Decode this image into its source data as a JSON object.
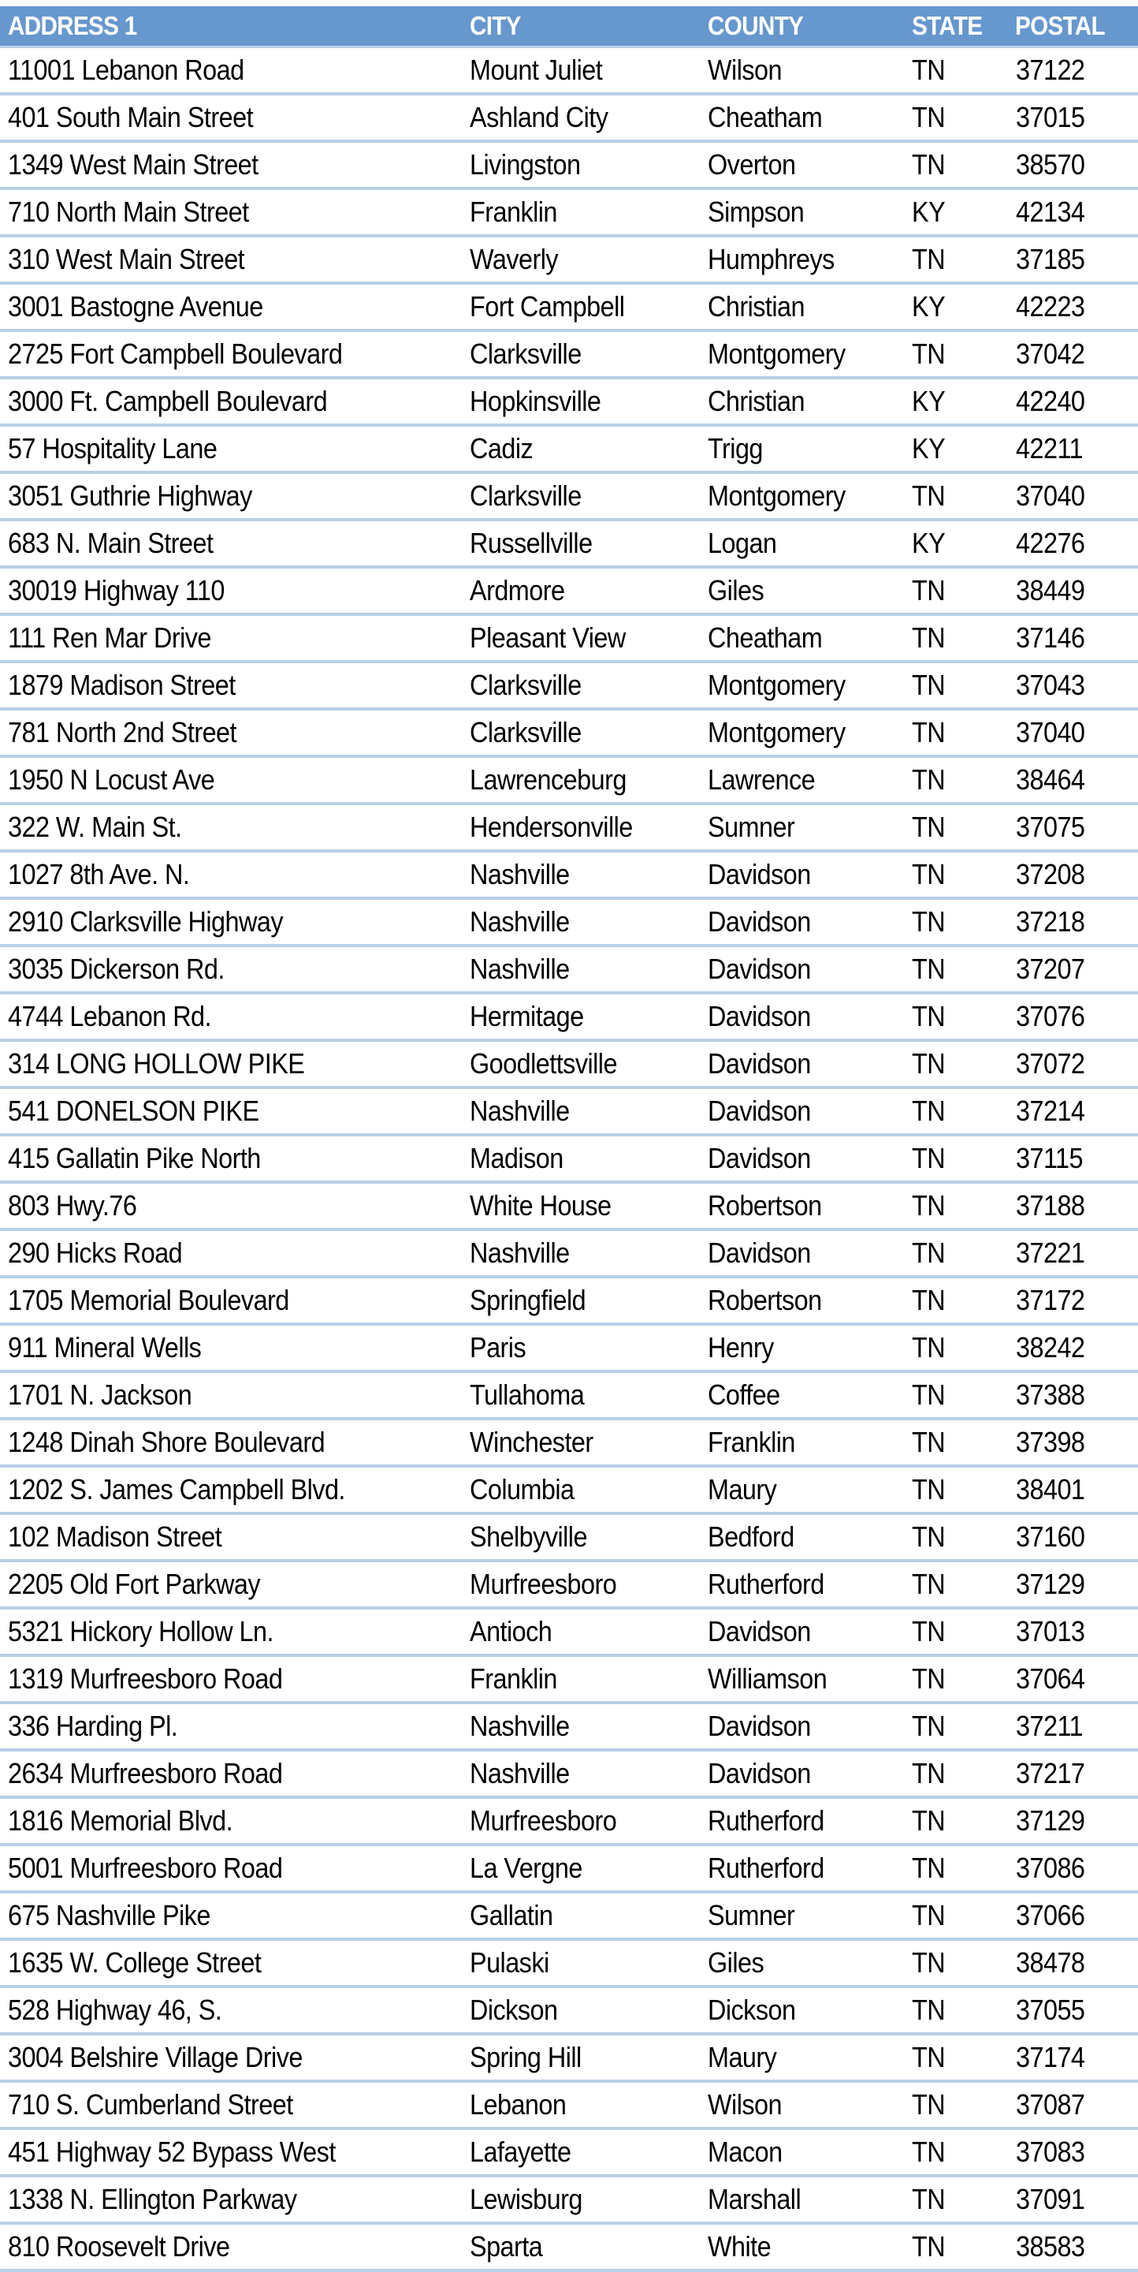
{
  "table": {
    "headers": [
      "ADDRESS 1",
      "CITY",
      "COUNTY",
      "STATE",
      "POSTAL"
    ],
    "accent_color": "#6697CD",
    "rows": [
      [
        "11001 Lebanon Road",
        "Mount Juliet",
        "Wilson",
        "TN",
        "37122"
      ],
      [
        "401 South Main Street",
        "Ashland City",
        "Cheatham",
        "TN",
        "37015"
      ],
      [
        "1349 West Main Street",
        "Livingston",
        "Overton",
        "TN",
        "38570"
      ],
      [
        "710 North Main Street",
        "Franklin",
        "Simpson",
        "KY",
        "42134"
      ],
      [
        "310 West Main Street",
        "Waverly",
        "Humphreys",
        "TN",
        "37185"
      ],
      [
        "3001 Bastogne Avenue",
        "Fort Campbell",
        "Christian",
        "KY",
        "42223"
      ],
      [
        "2725 Fort Campbell Boulevard",
        "Clarksville",
        "Montgomery",
        "TN",
        "37042"
      ],
      [
        "3000 Ft. Campbell Boulevard",
        "Hopkinsville",
        "Christian",
        "KY",
        "42240"
      ],
      [
        "57 Hospitality Lane",
        "Cadiz",
        "Trigg",
        "KY",
        "42211"
      ],
      [
        "3051 Guthrie Highway",
        "Clarksville",
        "Montgomery",
        "TN",
        "37040"
      ],
      [
        "683 N. Main Street",
        "Russellville",
        "Logan",
        "KY",
        "42276"
      ],
      [
        "30019 Highway 110",
        "Ardmore",
        "Giles",
        "TN",
        "38449"
      ],
      [
        "111 Ren Mar Drive",
        "Pleasant View",
        "Cheatham",
        "TN",
        "37146"
      ],
      [
        "1879 Madison Street",
        "Clarksville",
        "Montgomery",
        "TN",
        "37043"
      ],
      [
        "781 North 2nd Street",
        "Clarksville",
        "Montgomery",
        "TN",
        "37040"
      ],
      [
        "1950 N Locust Ave",
        "Lawrenceburg",
        "Lawrence",
        "TN",
        "38464"
      ],
      [
        "322 W. Main St.",
        "Hendersonville",
        "Sumner",
        "TN",
        "37075"
      ],
      [
        "1027 8th Ave. N.",
        "Nashville",
        "Davidson",
        "TN",
        "37208"
      ],
      [
        "2910 Clarksville Highway",
        "Nashville",
        "Davidson",
        "TN",
        "37218"
      ],
      [
        "3035 Dickerson Rd.",
        "Nashville",
        "Davidson",
        "TN",
        "37207"
      ],
      [
        "4744 Lebanon Rd.",
        "Hermitage",
        "Davidson",
        "TN",
        "37076"
      ],
      [
        "314 LONG HOLLOW PIKE",
        "Goodlettsville",
        "Davidson",
        "TN",
        "37072"
      ],
      [
        "541 DONELSON PIKE",
        "Nashville",
        "Davidson",
        "TN",
        "37214"
      ],
      [
        "415 Gallatin Pike North",
        "Madison",
        "Davidson",
        "TN",
        "37115"
      ],
      [
        "803 Hwy.76",
        "White House",
        "Robertson",
        "TN",
        "37188"
      ],
      [
        "290 Hicks Road",
        "Nashville",
        "Davidson",
        "TN",
        "37221"
      ],
      [
        "1705 Memorial Boulevard",
        "Springfield",
        "Robertson",
        "TN",
        "37172"
      ],
      [
        "911 Mineral Wells",
        "Paris",
        "Henry",
        "TN",
        "38242"
      ],
      [
        "1701 N. Jackson",
        "Tullahoma",
        "Coffee",
        "TN",
        "37388"
      ],
      [
        "1248 Dinah Shore Boulevard",
        "Winchester",
        "Franklin",
        "TN",
        "37398"
      ],
      [
        "1202 S. James Campbell Blvd.",
        "Columbia",
        "Maury",
        "TN",
        "38401"
      ],
      [
        "102 Madison Street",
        "Shelbyville",
        "Bedford",
        "TN",
        "37160"
      ],
      [
        "2205 Old Fort Parkway",
        "Murfreesboro",
        "Rutherford",
        "TN",
        "37129"
      ],
      [
        "5321 Hickory Hollow Ln.",
        "Antioch",
        "Davidson",
        "TN",
        "37013"
      ],
      [
        "1319 Murfreesboro Road",
        "Franklin",
        "Williamson",
        "TN",
        "37064"
      ],
      [
        "336 Harding Pl.",
        "Nashville",
        "Davidson",
        "TN",
        "37211"
      ],
      [
        "2634 Murfreesboro Road",
        "Nashville",
        "Davidson",
        "TN",
        "37217"
      ],
      [
        "1816 Memorial Blvd.",
        "Murfreesboro",
        "Rutherford",
        "TN",
        "37129"
      ],
      [
        "5001 Murfreesboro Road",
        "La Vergne",
        "Rutherford",
        "TN",
        "37086"
      ],
      [
        "675 Nashville Pike",
        "Gallatin",
        "Sumner",
        "TN",
        "37066"
      ],
      [
        "1635 W. College Street",
        "Pulaski",
        "Giles",
        "TN",
        "38478"
      ],
      [
        "528 Highway 46, S.",
        "Dickson",
        "Dickson",
        "TN",
        "37055"
      ],
      [
        "3004 Belshire Village Drive",
        "Spring Hill",
        "Maury",
        "TN",
        "37174"
      ],
      [
        "710 S. Cumberland Street",
        "Lebanon",
        "Wilson",
        "TN",
        "37087"
      ],
      [
        "451 Highway 52 Bypass West",
        "Lafayette",
        "Macon",
        "TN",
        "37083"
      ],
      [
        "1338 N. Ellington Parkway",
        "Lewisburg",
        "Marshall",
        "TN",
        "37091"
      ],
      [
        "810 Roosevelt Drive",
        "Sparta",
        "White",
        "TN",
        "38583"
      ]
    ]
  }
}
